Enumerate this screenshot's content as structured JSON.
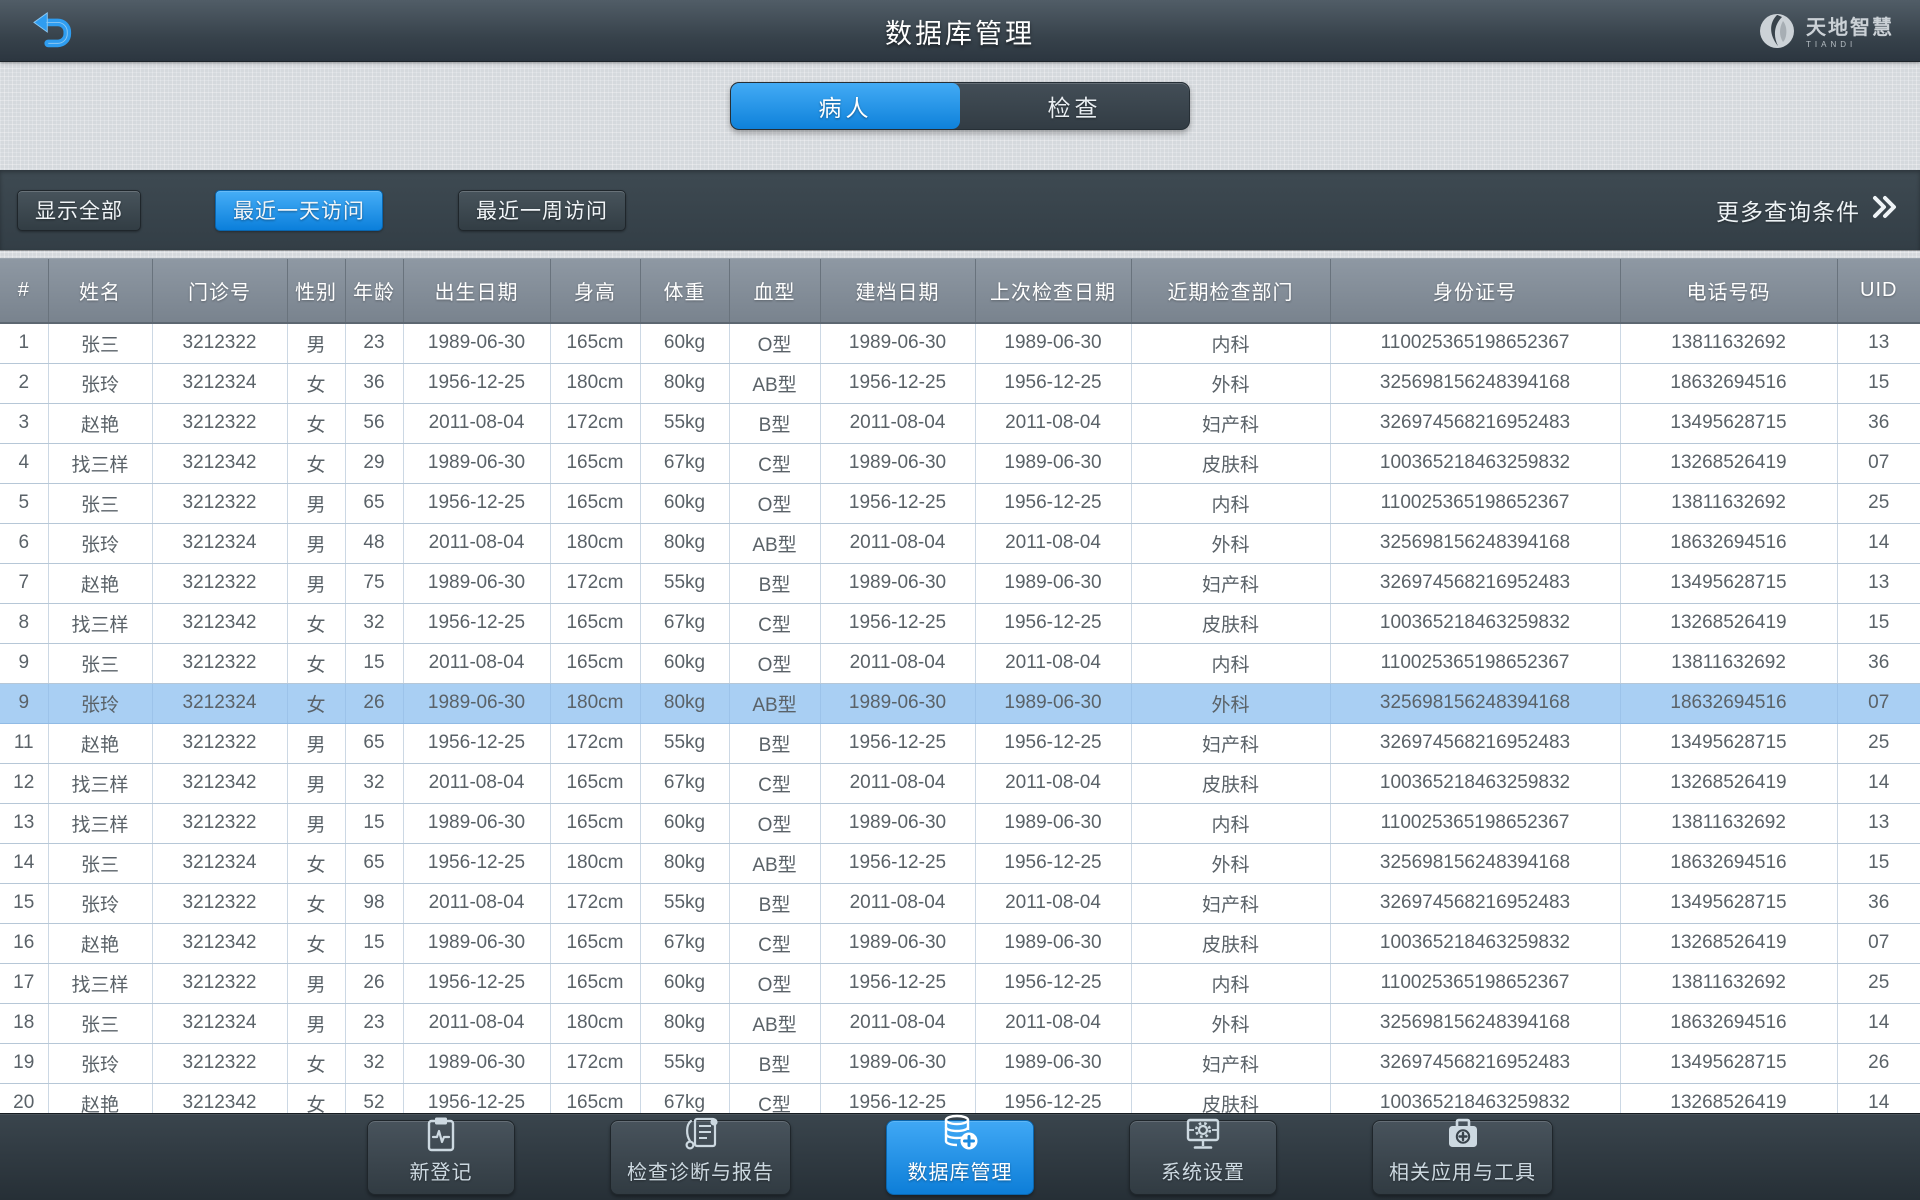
{
  "header": {
    "title": "数据库管理",
    "logo": {
      "name": "天地智慧",
      "subname": "TIANDI"
    }
  },
  "tabs": [
    {
      "label": "病人",
      "active": true
    },
    {
      "label": "检查",
      "active": false
    }
  ],
  "filters": {
    "buttons": [
      {
        "label": "显示全部",
        "active": false
      },
      {
        "label": "最近一天访问",
        "active": true
      },
      {
        "label": "最近一周访问",
        "active": false
      }
    ],
    "more_label": "更多查询条件"
  },
  "table": {
    "columns": [
      "#",
      "姓名",
      "门诊号",
      "性别",
      "年龄",
      "出生日期",
      "身高",
      "体重",
      "血型",
      "建档日期",
      "上次检查日期",
      "近期检查部门",
      "身份证号",
      "电话号码",
      "UID"
    ],
    "highlight_color": "#a9cff3",
    "rows": [
      {
        "highlight": false,
        "cells": [
          "1",
          "张三",
          "3212322",
          "男",
          "23",
          "1989-06-30",
          "165cm",
          "60kg",
          "O型",
          "1989-06-30",
          "1989-06-30",
          "内科",
          "110025365198652367",
          "13811632692",
          "13"
        ]
      },
      {
        "highlight": false,
        "cells": [
          "2",
          "张玲",
          "3212324",
          "女",
          "36",
          "1956-12-25",
          "180cm",
          "80kg",
          "AB型",
          "1956-12-25",
          "1956-12-25",
          "外科",
          "325698156248394168",
          "18632694516",
          "15"
        ]
      },
      {
        "highlight": false,
        "cells": [
          "3",
          "赵艳",
          "3212322",
          "女",
          "56",
          "2011-08-04",
          "172cm",
          "55kg",
          "B型",
          "2011-08-04",
          "2011-08-04",
          "妇产科",
          "326974568216952483",
          "13495628715",
          "36"
        ]
      },
      {
        "highlight": false,
        "cells": [
          "4",
          "找三样",
          "3212342",
          "女",
          "29",
          "1989-06-30",
          "165cm",
          "67kg",
          "C型",
          "1989-06-30",
          "1989-06-30",
          "皮肤科",
          "100365218463259832",
          "13268526419",
          "07"
        ]
      },
      {
        "highlight": false,
        "cells": [
          "5",
          "张三",
          "3212322",
          "男",
          "65",
          "1956-12-25",
          "165cm",
          "60kg",
          "O型",
          "1956-12-25",
          "1956-12-25",
          "内科",
          "110025365198652367",
          "13811632692",
          "25"
        ]
      },
      {
        "highlight": false,
        "cells": [
          "6",
          "张玲",
          "3212324",
          "男",
          "48",
          "2011-08-04",
          "180cm",
          "80kg",
          "AB型",
          "2011-08-04",
          "2011-08-04",
          "外科",
          "325698156248394168",
          "18632694516",
          "14"
        ]
      },
      {
        "highlight": false,
        "cells": [
          "7",
          "赵艳",
          "3212322",
          "男",
          "75",
          "1989-06-30",
          "172cm",
          "55kg",
          "B型",
          "1989-06-30",
          "1989-06-30",
          "妇产科",
          "326974568216952483",
          "13495628715",
          "13"
        ]
      },
      {
        "highlight": false,
        "cells": [
          "8",
          "找三样",
          "3212342",
          "女",
          "32",
          "1956-12-25",
          "165cm",
          "67kg",
          "C型",
          "1956-12-25",
          "1956-12-25",
          "皮肤科",
          "100365218463259832",
          "13268526419",
          "15"
        ]
      },
      {
        "highlight": false,
        "cells": [
          "9",
          "张三",
          "3212322",
          "女",
          "15",
          "2011-08-04",
          "165cm",
          "60kg",
          "O型",
          "2011-08-04",
          "2011-08-04",
          "内科",
          "110025365198652367",
          "13811632692",
          "36"
        ]
      },
      {
        "highlight": true,
        "cells": [
          "9",
          "张玲",
          "3212324",
          "女",
          "26",
          "1989-06-30",
          "180cm",
          "80kg",
          "AB型",
          "1989-06-30",
          "1989-06-30",
          "外科",
          "325698156248394168",
          "18632694516",
          "07"
        ]
      },
      {
        "highlight": false,
        "cells": [
          "11",
          "赵艳",
          "3212322",
          "男",
          "65",
          "1956-12-25",
          "172cm",
          "55kg",
          "B型",
          "1956-12-25",
          "1956-12-25",
          "妇产科",
          "326974568216952483",
          "13495628715",
          "25"
        ]
      },
      {
        "highlight": false,
        "cells": [
          "12",
          "找三样",
          "3212342",
          "男",
          "32",
          "2011-08-04",
          "165cm",
          "67kg",
          "C型",
          "2011-08-04",
          "2011-08-04",
          "皮肤科",
          "100365218463259832",
          "13268526419",
          "14"
        ]
      },
      {
        "highlight": false,
        "cells": [
          "13",
          "找三样",
          "3212322",
          "男",
          "15",
          "1989-06-30",
          "165cm",
          "60kg",
          "O型",
          "1989-06-30",
          "1989-06-30",
          "内科",
          "110025365198652367",
          "13811632692",
          "13"
        ]
      },
      {
        "highlight": false,
        "cells": [
          "14",
          "张三",
          "3212324",
          "女",
          "65",
          "1956-12-25",
          "180cm",
          "80kg",
          "AB型",
          "1956-12-25",
          "1956-12-25",
          "外科",
          "325698156248394168",
          "18632694516",
          "15"
        ]
      },
      {
        "highlight": false,
        "cells": [
          "15",
          "张玲",
          "3212322",
          "女",
          "98",
          "2011-08-04",
          "172cm",
          "55kg",
          "B型",
          "2011-08-04",
          "2011-08-04",
          "妇产科",
          "326974568216952483",
          "13495628715",
          "36"
        ]
      },
      {
        "highlight": false,
        "cells": [
          "16",
          "赵艳",
          "3212342",
          "女",
          "15",
          "1989-06-30",
          "165cm",
          "67kg",
          "C型",
          "1989-06-30",
          "1989-06-30",
          "皮肤科",
          "100365218463259832",
          "13268526419",
          "07"
        ]
      },
      {
        "highlight": false,
        "cells": [
          "17",
          "找三样",
          "3212322",
          "男",
          "26",
          "1956-12-25",
          "165cm",
          "60kg",
          "O型",
          "1956-12-25",
          "1956-12-25",
          "内科",
          "110025365198652367",
          "13811632692",
          "25"
        ]
      },
      {
        "highlight": false,
        "cells": [
          "18",
          "张三",
          "3212324",
          "男",
          "23",
          "2011-08-04",
          "180cm",
          "80kg",
          "AB型",
          "2011-08-04",
          "2011-08-04",
          "外科",
          "325698156248394168",
          "18632694516",
          "14"
        ]
      },
      {
        "highlight": false,
        "cells": [
          "19",
          "张玲",
          "3212322",
          "女",
          "32",
          "1989-06-30",
          "172cm",
          "55kg",
          "B型",
          "1989-06-30",
          "1989-06-30",
          "妇产科",
          "326974568216952483",
          "13495628715",
          "26"
        ]
      },
      {
        "highlight": false,
        "cells": [
          "20",
          "赵艳",
          "3212342",
          "女",
          "52",
          "1956-12-25",
          "165cm",
          "67kg",
          "C型",
          "1956-12-25",
          "1956-12-25",
          "皮肤科",
          "100365218463259832",
          "13268526419",
          "14"
        ]
      }
    ]
  },
  "nav": {
    "items": [
      {
        "label": "新登记",
        "icon": "register-icon",
        "active": false
      },
      {
        "label": "检查诊断与报告",
        "icon": "report-icon",
        "active": false
      },
      {
        "label": "数据库管理",
        "icon": "database-icon",
        "active": true
      },
      {
        "label": "系统设置",
        "icon": "settings-icon",
        "active": false
      },
      {
        "label": "相关应用与工具",
        "icon": "tools-icon",
        "active": false
      }
    ]
  },
  "colors": {
    "accent_blue": "#1b8de4",
    "bar_dark": "#333e46",
    "header_gray": "#828c97",
    "row_highlight": "#a9cff3"
  }
}
